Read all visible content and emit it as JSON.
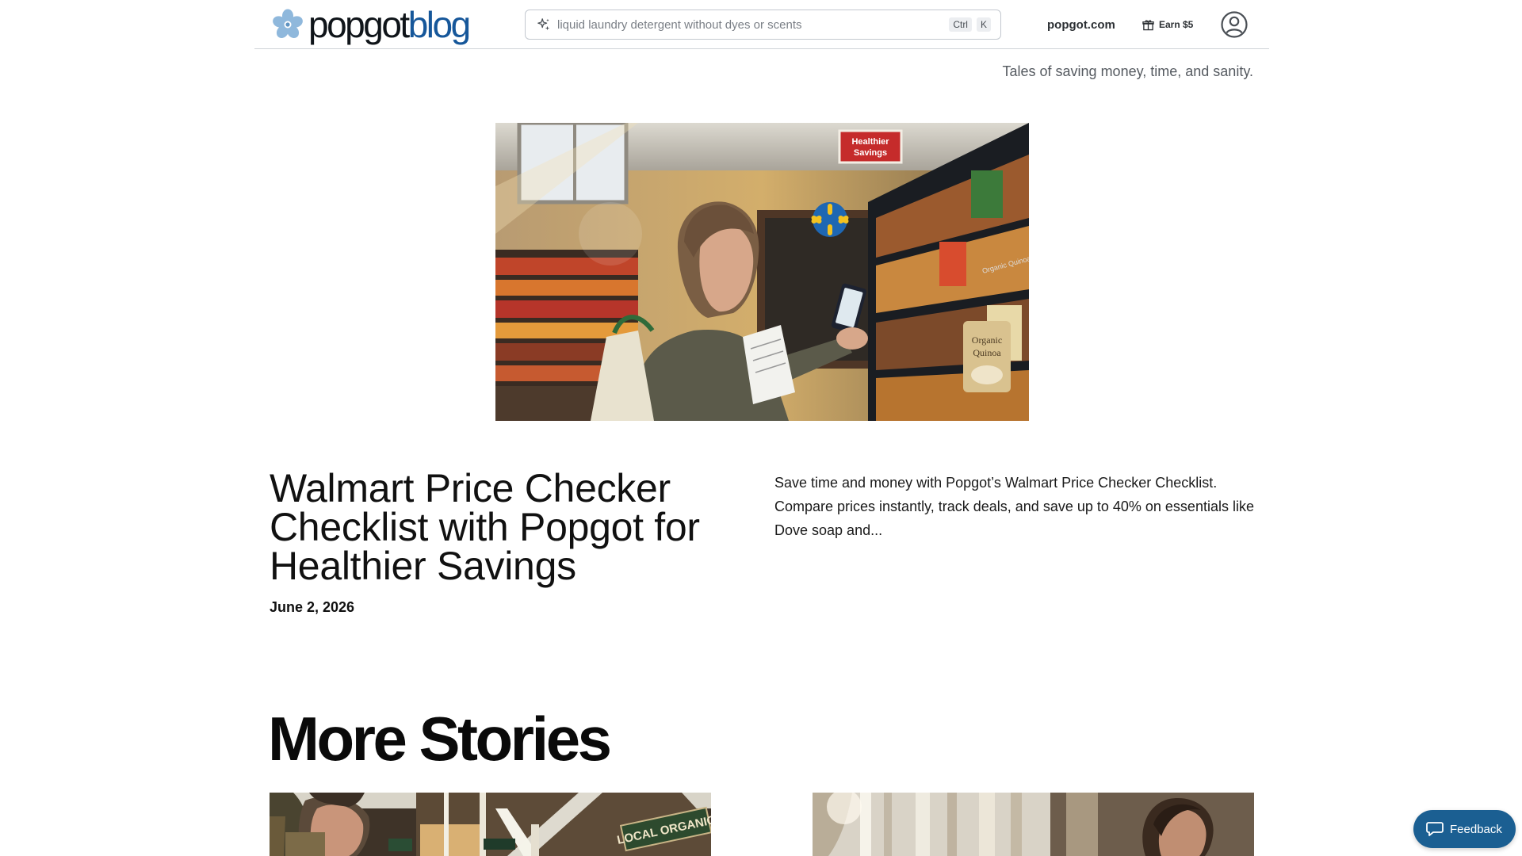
{
  "header": {
    "logo": {
      "part1": "popgot",
      "part2": "blog"
    },
    "search": {
      "placeholder": "liquid laundry detergent without dyes or scents",
      "shortcut_ctrl": "Ctrl",
      "shortcut_key": "K"
    },
    "site_link": "popgot.com",
    "earn_label": "Earn $5"
  },
  "tagline": "Tales of saving money, time, and sanity.",
  "featured": {
    "title": "Walmart Price Checker Checklist with Popgot for Healthier Savings",
    "date": "June 2, 2026",
    "excerpt": "Save time and money with Popgot’s Walmart Price Checker Checklist. Compare prices instantly, track deals, and save up to 40% on essentials like Dove soap and...",
    "image": {
      "shelf_sign": [
        "Healthier",
        "Savings"
      ],
      "product_label": [
        "Organic",
        "Quinoa"
      ],
      "shelf_tag": "Organic Quinoa"
    }
  },
  "more_stories": {
    "title": "More Stories",
    "cards": [
      {
        "sign_text": "LOCAL ORGANIC"
      },
      {
        "sign_text": ""
      }
    ]
  },
  "feedback_label": "Feedback",
  "colors": {
    "brand_blue": "#16579a",
    "feedback_bg": "#1b5f92",
    "logo_flower": "#8fb8dc"
  }
}
